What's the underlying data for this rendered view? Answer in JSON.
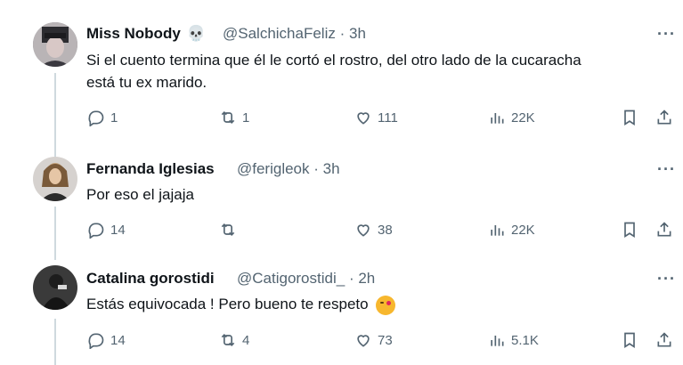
{
  "tweets": [
    {
      "name": "Miss Nobody",
      "name_emoji": "💀",
      "handle": "@SalchichaFeliz",
      "time": "· 3h",
      "text_lines": [
        "Si el cuento termina que él le cortó el rostro, del otro lado de la cucaracha",
        "está tu ex marido."
      ],
      "replies": "1",
      "retweets": "1",
      "likes": "111",
      "views": "22K"
    },
    {
      "name": "Fernanda Iglesias",
      "handle": "@ferigleok",
      "time": "· 3h",
      "text_lines": [
        "Por eso el jajaja"
      ],
      "replies": "14",
      "retweets": "",
      "likes": "38",
      "views": "22K"
    },
    {
      "name": "Catalina gorostidi",
      "handle": "@Catigorostidi_",
      "time": "· 2h",
      "text_lines": [
        "Estás equivocada ! Pero bueno te respeto"
      ],
      "text_emoji": "face-blowing-kiss-emoji",
      "replies": "14",
      "retweets": "4",
      "likes": "73",
      "views": "5.1K"
    }
  ],
  "more_label": "···",
  "colors": {
    "text": "#0f1419",
    "secondary": "#536471",
    "thread": "#cfd9de"
  }
}
